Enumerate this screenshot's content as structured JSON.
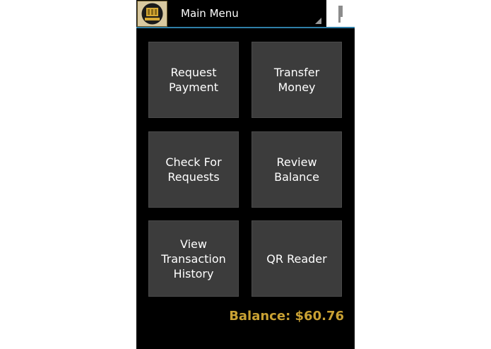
{
  "action_bar": {
    "menu_title": "Main Menu",
    "icon": "app-logo-icon",
    "overflow_icon": "overflow-icon",
    "accent_color": "#2f7fa8"
  },
  "menu": {
    "buttons": [
      {
        "id": "request-payment",
        "label": "Request\nPayment"
      },
      {
        "id": "transfer-money",
        "label": "Transfer\nMoney"
      },
      {
        "id": "check-for-requests",
        "label": "Check For\nRequests"
      },
      {
        "id": "review-balance",
        "label": "Review\nBalance"
      },
      {
        "id": "view-transaction-history",
        "label": "View\nTransaction\nHistory"
      },
      {
        "id": "qr-reader",
        "label": "QR Reader"
      }
    ],
    "button_color": "#3c3c3c"
  },
  "balance": {
    "text": "Balance: $60.76",
    "color": "#c9a133"
  }
}
